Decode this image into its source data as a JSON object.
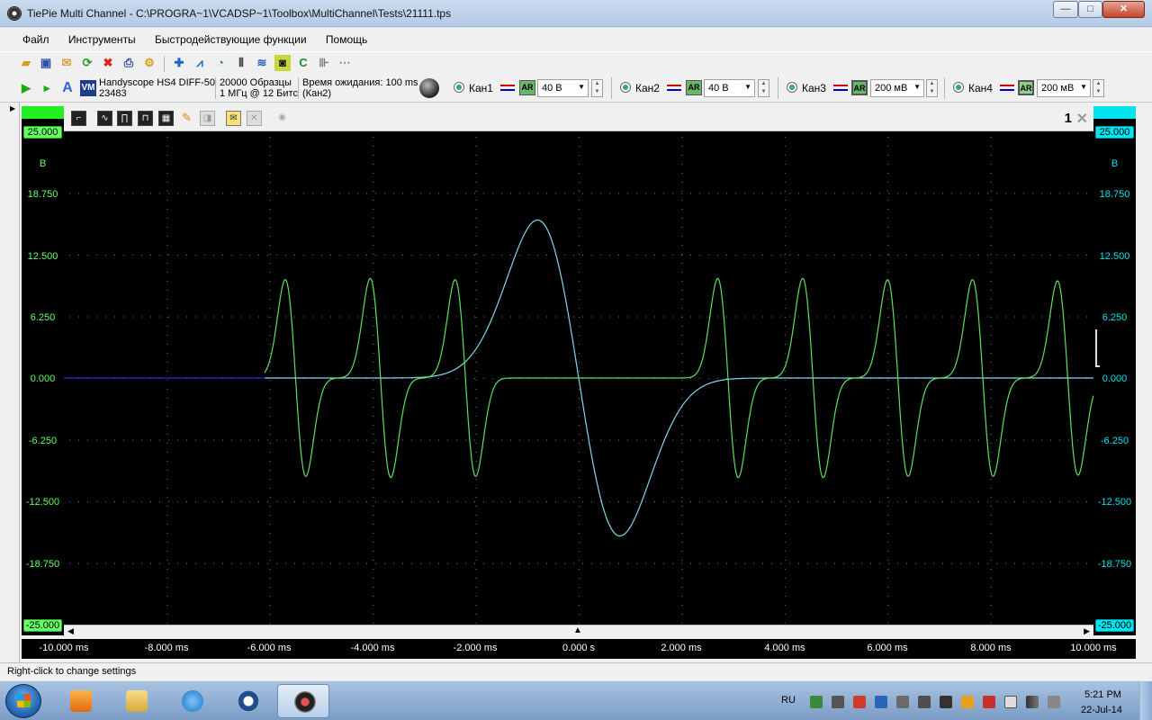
{
  "window": {
    "title": "TiePie Multi Channel - C:\\PROGRA~1\\VCADSP~1\\Toolbox\\MultiChannel\\Tests\\21111.tps",
    "min_glyph": "—",
    "max_glyph": "□",
    "close_glyph": "✕"
  },
  "menu": [
    "Файл",
    "Инструменты",
    "Быстродействующие функции",
    "Помощь"
  ],
  "device": {
    "name": "Handyscope HS4 DIFF-50",
    "serial": "23483",
    "samples": "20000 Образцы",
    "rate": "1 МГц @ 12 Битс",
    "wait_label": "Время ожидания:",
    "wait_value": "100 ms",
    "wait_channel": "(Кан2)"
  },
  "channels": [
    {
      "label": "Кан1",
      "ar": "AR",
      "range": "40 В"
    },
    {
      "label": "Кан2",
      "ar": "AR",
      "range": "40 В"
    },
    {
      "label": "Кан3",
      "ar": "AR",
      "range": "200 мВ"
    },
    {
      "label": "Кан4",
      "ar": "AR",
      "range": "200 мВ"
    }
  ],
  "graph": {
    "number": "1",
    "left_axis": {
      "top": "25.000",
      "unit": "В",
      "ticks": [
        "18.750",
        "12.500",
        "6.250",
        "0.000",
        "-6.250",
        "-12.500",
        "-18.750"
      ],
      "bottom": "-25.000"
    },
    "right_axis": {
      "top": "25.000",
      "unit": "В",
      "ticks": [
        "18.750",
        "12.500",
        "6.250",
        "0.000",
        "-6.250",
        "-12.500",
        "-18.750"
      ],
      "bottom": "-25.000"
    },
    "x_ticks": [
      "-10.000 ms",
      "-8.000 ms",
      "-6.000 ms",
      "-4.000 ms",
      "-2.000 ms",
      "0.000 s",
      "2.000 ms",
      "4.000 ms",
      "6.000 ms",
      "8.000 ms",
      "10.000 ms"
    ],
    "colors": {
      "green": "#66ff66",
      "cyan": "#00e5ee",
      "trace_green": "#5ee05e",
      "trace_cyan": "#7fd8ee",
      "blue": "#2a2ad8"
    }
  },
  "chart_data": {
    "type": "line",
    "xlim": [
      -10,
      10
    ],
    "ylim": [
      -25,
      25
    ],
    "series": [
      {
        "pulses": [
          {
            "t": -5.5,
            "amp": 16.6
          },
          {
            "t": -3.85,
            "amp": 16.8
          },
          {
            "t": -2.2,
            "amp": 16.6
          },
          {
            "t": 2.9,
            "amp": 16.8
          },
          {
            "t": 4.55,
            "amp": 16.8
          },
          {
            "t": 6.2,
            "amp": 16.6
          },
          {
            "t": 7.85,
            "amp": 16.6
          },
          {
            "t": 9.5,
            "amp": 16.4
          }
        ],
        "start": -6.1
      },
      {
        "peak_t": -0.8,
        "peak_v": 16.0,
        "trough_t": 0.8,
        "trough_v": -16.0
      }
    ]
  },
  "status": "Right-click to change settings",
  "tray": {
    "lang": "RU",
    "time": "5:21 PM",
    "date": "22-Jul-14"
  }
}
